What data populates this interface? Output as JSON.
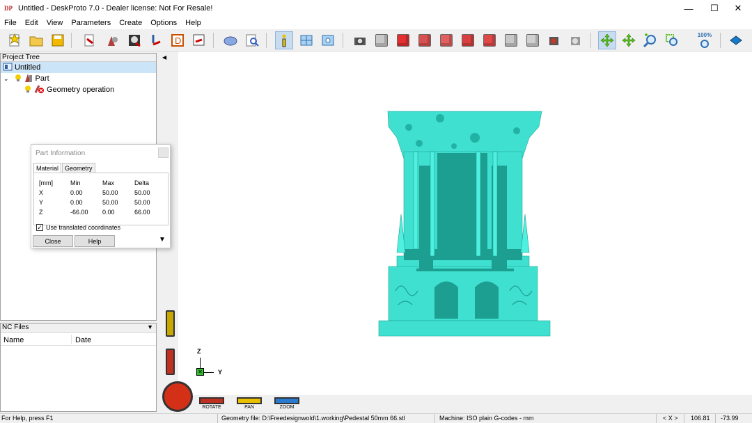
{
  "window": {
    "title": "Untitled - DeskProto 7.0 - Dealer license: Not For Resale!",
    "logo_text": "DP",
    "min": "—",
    "max": "☐",
    "close": "✕"
  },
  "menu": [
    "File",
    "Edit",
    "View",
    "Parameters",
    "Create",
    "Options",
    "Help"
  ],
  "toolbar": {
    "zoom_label": "100%"
  },
  "project_tree": {
    "header": "Project Tree",
    "root": "Untitled",
    "part": "Part",
    "operation": "Geometry operation"
  },
  "part_info": {
    "title": "Part Information",
    "tabs": [
      "Material",
      "Geometry"
    ],
    "columns": [
      "[mm]",
      "Min",
      "Max",
      "Delta"
    ],
    "rows": [
      {
        "axis": "X",
        "min": "0.00",
        "max": "50.00",
        "delta": "50.00"
      },
      {
        "axis": "Y",
        "min": "0.00",
        "max": "50.00",
        "delta": "50.00"
      },
      {
        "axis": "Z",
        "min": "-66.00",
        "max": "0.00",
        "delta": "66.00"
      }
    ],
    "checkbox_label": "Use translated coordinates",
    "checkbox_checked": true,
    "close_label": "Close",
    "help_label": "Help"
  },
  "nc_files": {
    "header": "NC Files",
    "columns": [
      "Name",
      "Date"
    ]
  },
  "viewport": {
    "axis_z": "Z",
    "axis_y": "Y",
    "rotate": "ROTATE",
    "pan": "PAN",
    "zoom": "ZOOM",
    "model_color": "#3fe0d0"
  },
  "status": {
    "help": "For Help, press F1",
    "geometry": "Geometry file: D:\\Freedesignwold\\1.working\\Pedestal 50mm 66.stl",
    "machine": "Machine: ISO plain G-codes - mm",
    "xlabel": "< X >",
    "x": "106.81",
    "y": "-73.99"
  }
}
